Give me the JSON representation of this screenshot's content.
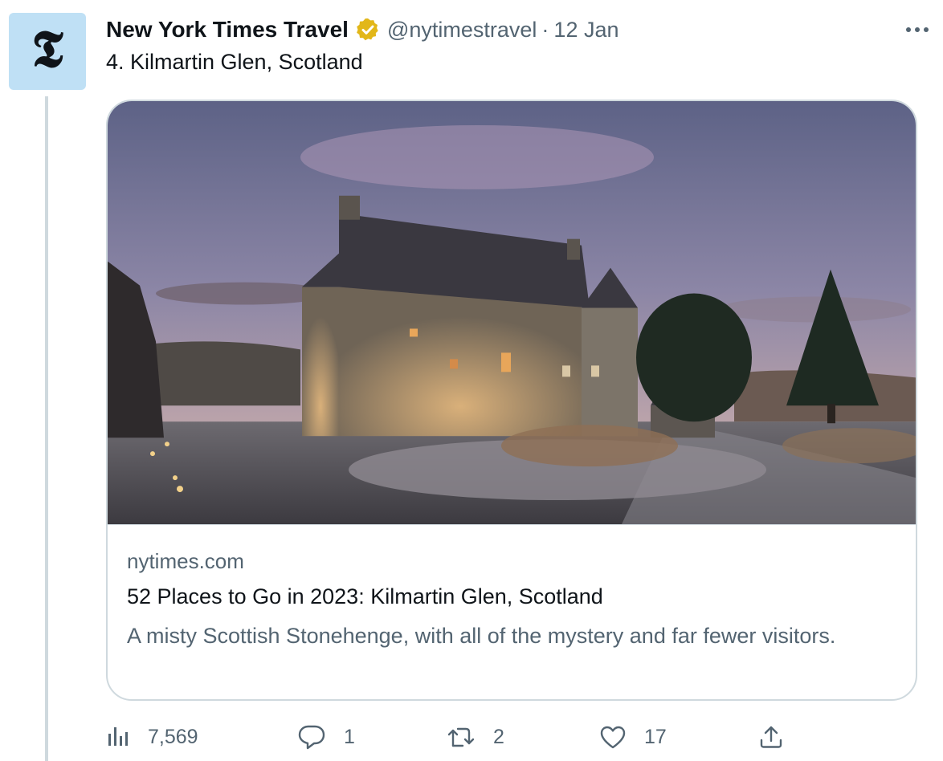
{
  "tweet": {
    "display_name": "New York Times Travel",
    "handle": "@nytimestravel",
    "separator": "·",
    "date": "12 Jan",
    "text": "4. Kilmartin Glen, Scotland",
    "avatar_glyph": "𝕿",
    "verified_badge": "verified-gold-icon",
    "more_icon": "more-dots-icon"
  },
  "card": {
    "domain": "nytimes.com",
    "title": "52 Places to Go in 2023: Kilmartin Glen, Scotland",
    "description": "A misty Scottish Stonehenge, with all of the mystery and far fewer visitors.",
    "image_subject": "stone-castle-photo"
  },
  "actions": {
    "views": {
      "icon": "views-icon",
      "count": "7,569"
    },
    "reply": {
      "icon": "reply-icon",
      "count": "1"
    },
    "retweet": {
      "icon": "retweet-icon",
      "count": "2"
    },
    "like": {
      "icon": "like-icon",
      "count": "17"
    },
    "share": {
      "icon": "share-icon"
    }
  },
  "colors": {
    "primary_text": "#0f1419",
    "secondary_text": "#536471",
    "border": "#cfd9de",
    "avatar_bg": "#bfe0f5",
    "verified_gold": "#e2b719"
  }
}
